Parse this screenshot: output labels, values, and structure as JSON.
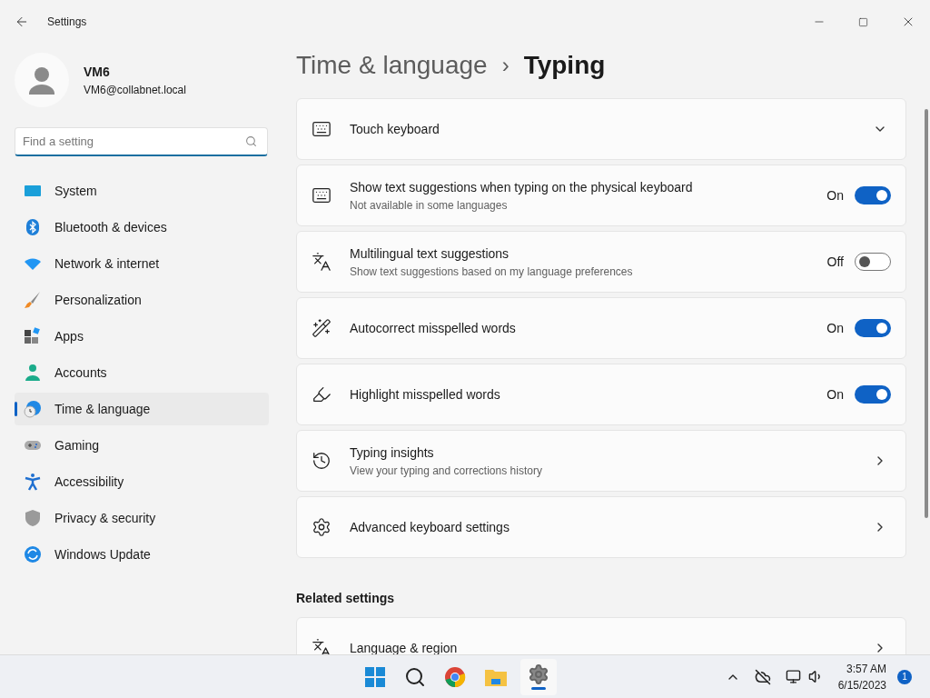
{
  "window": {
    "title": "Settings"
  },
  "user": {
    "name": "VM6",
    "email": "VM6@collabnet.local"
  },
  "search": {
    "placeholder": "Find a setting"
  },
  "sidebar": {
    "items": [
      {
        "label": "System",
        "selected": false
      },
      {
        "label": "Bluetooth & devices",
        "selected": false
      },
      {
        "label": "Network & internet",
        "selected": false
      },
      {
        "label": "Personalization",
        "selected": false
      },
      {
        "label": "Apps",
        "selected": false
      },
      {
        "label": "Accounts",
        "selected": false
      },
      {
        "label": "Time & language",
        "selected": true
      },
      {
        "label": "Gaming",
        "selected": false
      },
      {
        "label": "Accessibility",
        "selected": false
      },
      {
        "label": "Privacy & security",
        "selected": false
      },
      {
        "label": "Windows Update",
        "selected": false
      }
    ]
  },
  "breadcrumb": {
    "parent": "Time & language",
    "separator": "›",
    "current": "Typing"
  },
  "settings": [
    {
      "kind": "expander",
      "title": "Touch keyboard"
    },
    {
      "kind": "toggle",
      "title": "Show text suggestions when typing on the physical keyboard",
      "subtitle": "Not available in some languages",
      "state_label": "On",
      "on": true
    },
    {
      "kind": "toggle",
      "title": "Multilingual text suggestions",
      "subtitle": "Show text suggestions based on my language preferences",
      "state_label": "Off",
      "on": false
    },
    {
      "kind": "toggle",
      "title": "Autocorrect misspelled words",
      "state_label": "On",
      "on": true
    },
    {
      "kind": "toggle",
      "title": "Highlight misspelled words",
      "state_label": "On",
      "on": true
    },
    {
      "kind": "link",
      "title": "Typing insights",
      "subtitle": "View your typing and corrections history"
    },
    {
      "kind": "link",
      "title": "Advanced keyboard settings"
    }
  ],
  "related": {
    "heading": "Related settings",
    "items": [
      {
        "kind": "link",
        "title": "Language & region"
      }
    ]
  },
  "taskbar": {
    "time": "3:57 AM",
    "date": "6/15/2023",
    "notification_count": "1"
  }
}
